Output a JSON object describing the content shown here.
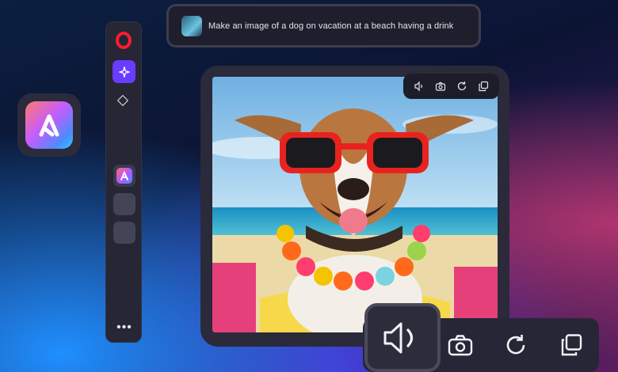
{
  "prompt": {
    "text": "Make an image of a dog on vacation at a beach having a drink",
    "avatar_icon": "user-avatar"
  },
  "sidebar": {
    "items": [
      {
        "icon": "opera-logo-icon"
      },
      {
        "icon": "aria-sparkle-icon",
        "active": true,
        "accent": "#6a3cff"
      },
      {
        "icon": "diamond-icon"
      },
      {
        "icon": "app-a-icon"
      },
      {
        "icon": "empty-slot"
      },
      {
        "icon": "empty-slot"
      },
      {
        "icon": "more-dots-icon"
      }
    ],
    "more_label": "•••"
  },
  "app_tile": {
    "icon": "app-a-icon"
  },
  "image_card": {
    "image_subject": "dog with red sunglasses and flower lei at beach",
    "toolbar": [
      "speaker-icon",
      "camera-icon",
      "refresh-icon",
      "copy-icon"
    ]
  },
  "bottom_toolbar": [
    "speaker-icon",
    "camera-icon",
    "refresh-icon",
    "copy-icon"
  ],
  "colors": {
    "opera_red": "#ff1b2d",
    "accent_purple": "#6a3cff",
    "panel": "#262636"
  }
}
